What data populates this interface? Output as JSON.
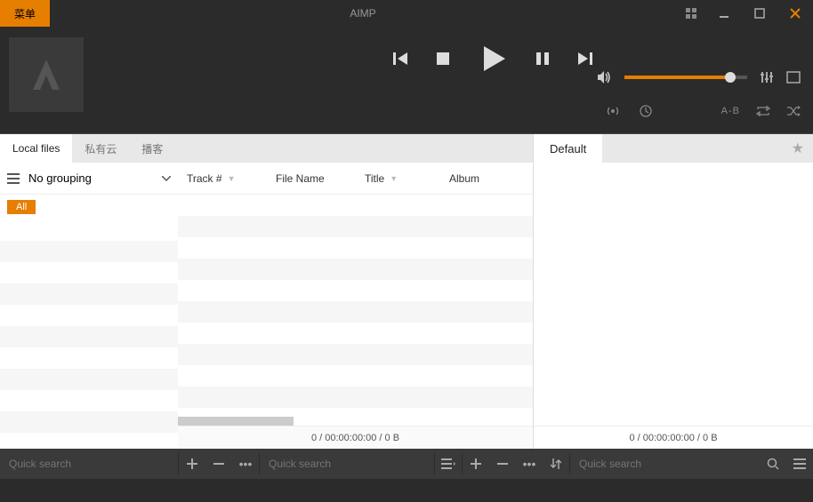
{
  "titlebar": {
    "menu_label": "菜单",
    "app_title": "AIMP"
  },
  "tabs": {
    "local_files": "Local files",
    "private_cloud": "私有云",
    "podcasts": "播客"
  },
  "sidebar": {
    "grouping_label": "No grouping",
    "all_label": "All"
  },
  "columns": {
    "track_num": "Track #",
    "file_name": "File Name",
    "title": "Title",
    "album": "Album"
  },
  "status": {
    "left": "0 / 00:00:00:00 / 0 B",
    "right": "0 / 00:00:00:00 / 0 B"
  },
  "playlist": {
    "default_tab": "Default"
  },
  "ab_label": "A-B",
  "search": {
    "placeholder": "Quick search"
  },
  "icons": {
    "volume": "volume-icon",
    "eq": "equalizer-icon",
    "vis": "visualizer-icon"
  }
}
